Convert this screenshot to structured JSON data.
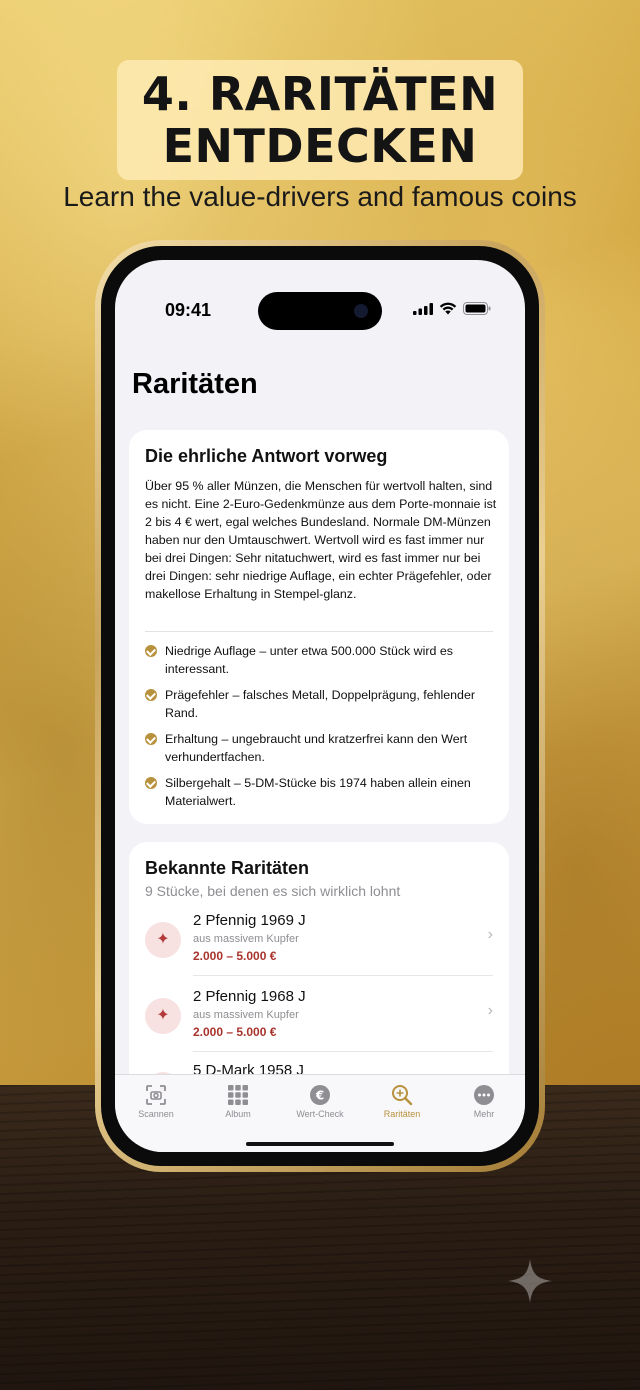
{
  "promo": {
    "title_line1": "4. RARITÄTEN",
    "title_line2": "ENTDECKEN",
    "subtitle": "Learn the value-drivers and famous coins"
  },
  "status_bar": {
    "time": "09:41",
    "icons": [
      "signal-icon",
      "wifi-icon",
      "battery-icon"
    ]
  },
  "screen": {
    "title": "Raritäten"
  },
  "answer_card": {
    "title": "Die ehrliche Antwort vorweg",
    "body": "Über 95 % aller Münzen, die Menschen für wertvoll halten, sind es nicht. Eine 2-Euro-Gedenkmünze aus dem Porte-monnaie ist 2 bis 4 € wert, egal welches Bundesland. Normale DM-Münzen haben nur den Umtauschwert. Wertvoll wird es fast immer nur bei drei Dingen: Sehr nitatuchwert, wird es fast immer nur bei drei Dingen: sehr niedrige Auflage, ein echter Prägefehler, oder makellose Erhaltung in Stempel-glanz.",
    "bullets": [
      "Niedrige Auflage – unter etwa 500.000 Stück wird es interessant.",
      "Prägefehler – falsches Metall, Doppelprägung, fehlender Rand.",
      "Erhaltung – ungebraucht und kratzerfrei kann den Wert verhundertfachen.",
      "Silbergehalt – 5-DM-Stücke bis 1974 haben allein einen Materialwert."
    ]
  },
  "rarities": {
    "title": "Bekannte Raritäten",
    "subtitle": "9 Stücke, bei denen es sich wirklich lohnt",
    "items": [
      {
        "name": "2 Pfennig 1969 J",
        "material": "aus massivem Kupfer",
        "price": "2.000 – 5.000 €"
      },
      {
        "name": "2 Pfennig 1968 J",
        "material": "aus massivem Kupfer",
        "price": "2.000 – 5.000 €"
      },
      {
        "name": "5 D-Mark 1958 J",
        "material": "",
        "price": ""
      }
    ]
  },
  "tabbar": {
    "tabs": [
      {
        "label": "Scannen",
        "icon": "camera-scan-icon"
      },
      {
        "label": "Album",
        "icon": "grid-icon"
      },
      {
        "label": "Wert-Check",
        "icon": "euro-coin-icon"
      },
      {
        "label": "Raritäten",
        "icon": "magnifier-icon",
        "active": true
      },
      {
        "label": "Mehr",
        "icon": "more-icon"
      }
    ]
  },
  "colors": {
    "accent_gold": "#b8913c",
    "price_red": "#a8332c"
  }
}
